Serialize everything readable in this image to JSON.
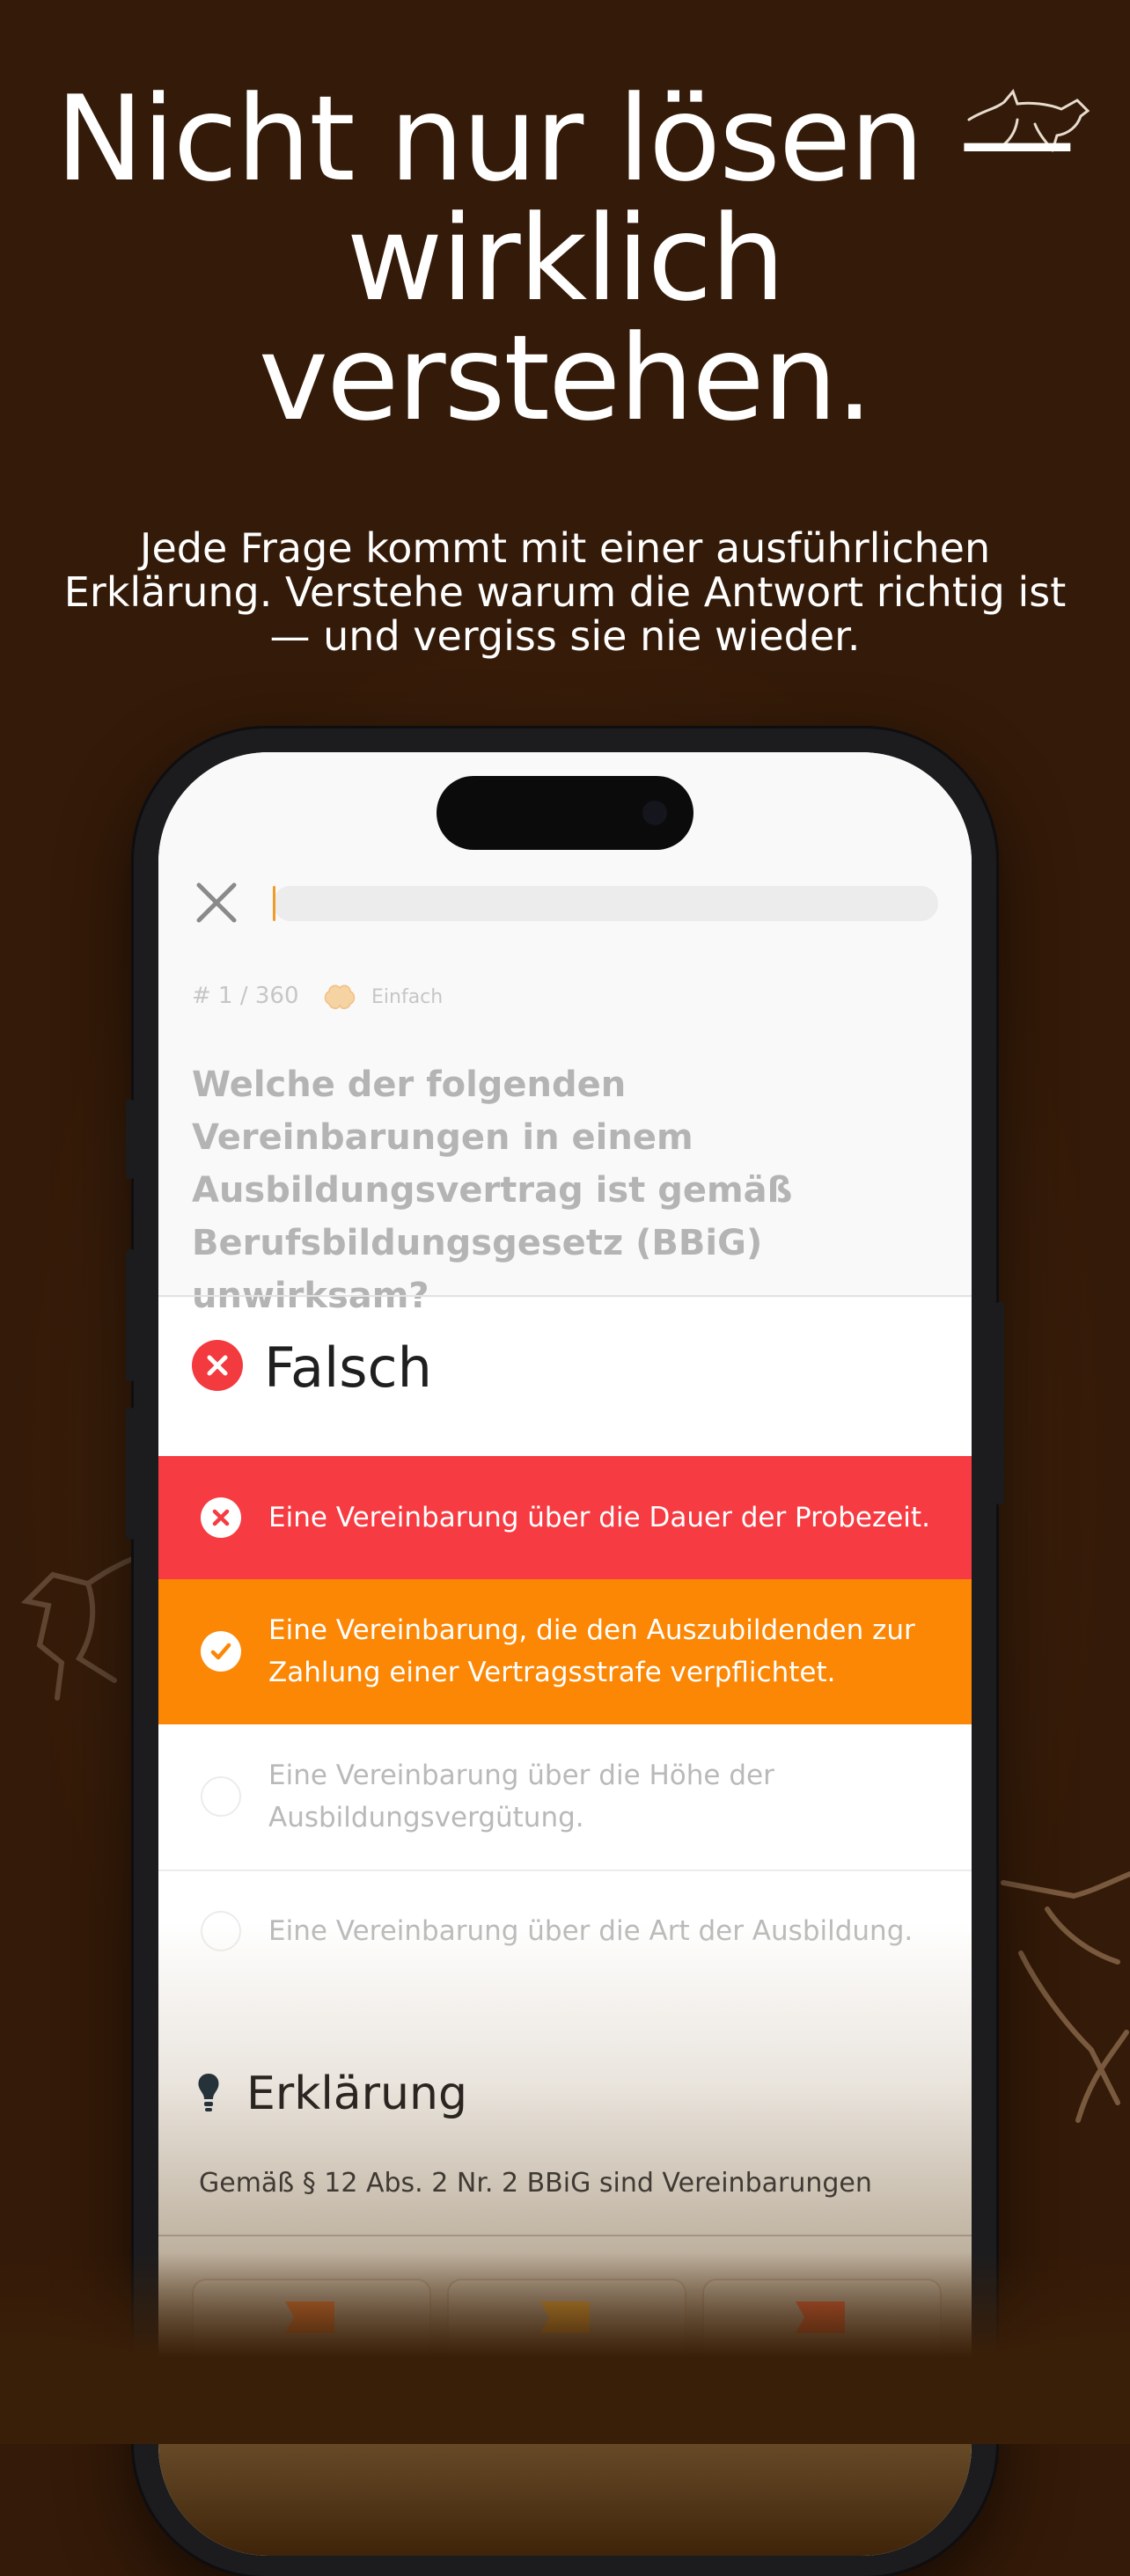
{
  "promo": {
    "headline_lines": [
      "Nicht nur lösen —",
      "wirklich",
      "verstehen."
    ],
    "subline": "Jede Frage kommt mit einer ausführlichen Erklärung. Verstehe warum die Antwort richtig ist — und vergiss sie nie wieder."
  },
  "quiz": {
    "progress_fraction": 0.003,
    "counter": "# 1 / 360",
    "difficulty": "Einfach",
    "question": "Welche der folgenden Vereinbarungen in einem Ausbildungsvertrag ist gemäß Berufsbildungsgesetz (BBiG) unwirksam?",
    "result_label": "Falsch",
    "answers": [
      {
        "text": "Eine Vereinbarung über die Dauer der Probezeit.",
        "state": "wrong"
      },
      {
        "text": "Eine Vereinbarung, die den Auszubildenden zur Zahlung einer Vertragsstrafe verpflichtet.",
        "state": "correct"
      },
      {
        "text": "Eine Vereinbarung über die Höhe der Ausbildungsvergütung.",
        "state": "neutral"
      },
      {
        "text": "Eine Vereinbarung über die Art der Ausbildung.",
        "state": "neutral"
      }
    ],
    "explanation_title": "Erklärung",
    "explanation_text": "Gemäß § 12 Abs. 2 Nr. 2 BBiG sind Vereinbarungen"
  },
  "colors": {
    "background": "#341a08",
    "wrong": "#f63c42",
    "correct": "#fb8705",
    "progress": "#f09a2a"
  },
  "icons": {
    "close": "close-icon",
    "difficulty": "brain-icon",
    "wrong": "x-circle-icon",
    "correct": "check-circle-icon",
    "explanation": "lightbulb-icon"
  }
}
